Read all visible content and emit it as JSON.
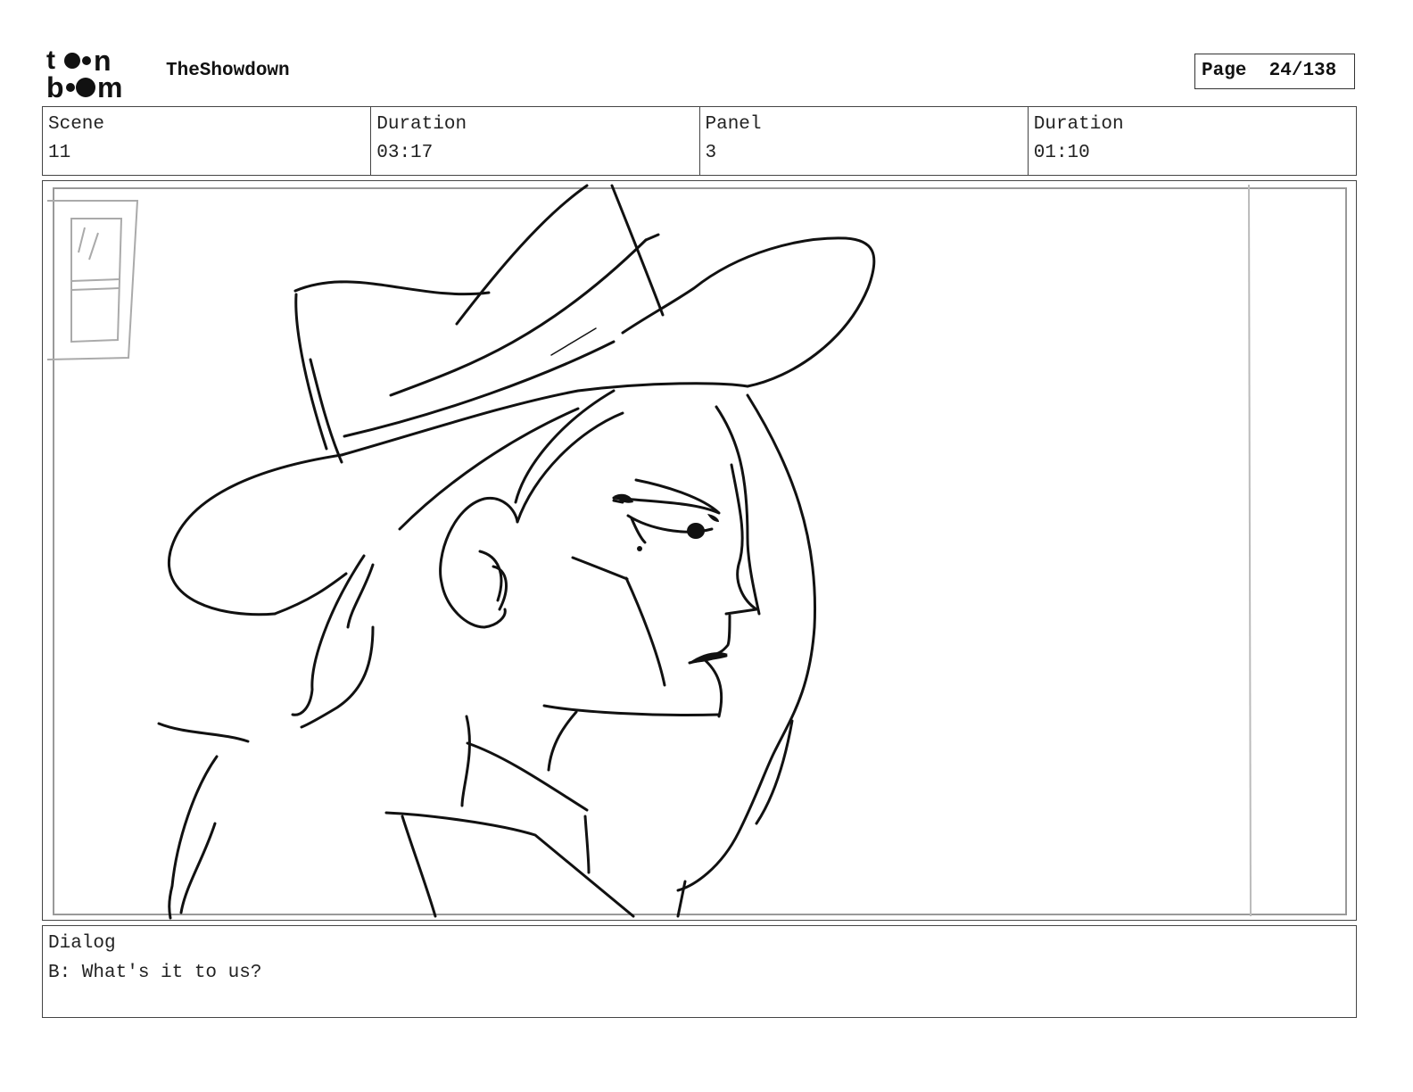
{
  "header": {
    "logo_text": "toon boom",
    "project_title": "TheShowdown",
    "page_label": "Page",
    "page_value": "24/138"
  },
  "info": {
    "scene_label": "Scene",
    "scene_value": "11",
    "scene_duration_label": "Duration",
    "scene_duration_value": "03:17",
    "panel_label": "Panel",
    "panel_value": "3",
    "panel_duration_label": "Duration",
    "panel_duration_value": "01:10"
  },
  "dialog": {
    "label": "Dialog",
    "text": "B: What's it to us?"
  }
}
